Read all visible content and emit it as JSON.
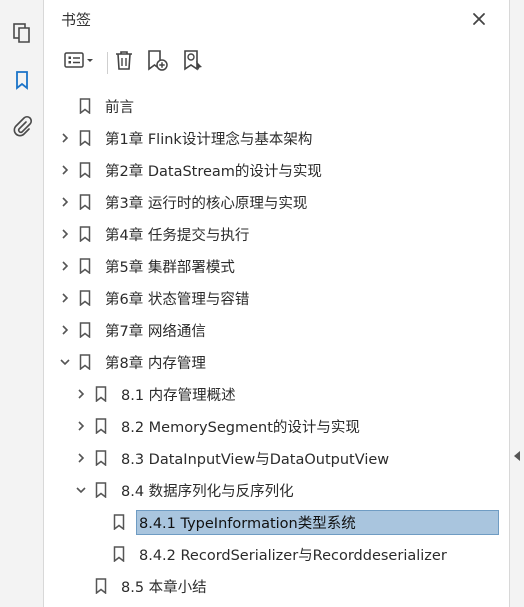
{
  "panel": {
    "title": "书签"
  },
  "rail": {
    "items": [
      "pages-icon",
      "bookmark-icon",
      "attachment-icon"
    ]
  },
  "toolbar": {
    "items": [
      "options-menu",
      "delete-bookmark",
      "new-bookmark",
      "find-current-bookmark"
    ]
  },
  "colors": {
    "accent": "#1a73c8",
    "selection": "#a9c5de",
    "selection_border": "#6f9cc3"
  },
  "bookmarks": [
    {
      "label": "前言",
      "expanded": null,
      "selected": false
    },
    {
      "label": "第1章 Flink设计理念与基本架构",
      "expanded": false,
      "selected": false
    },
    {
      "label": "第2章 DataStream的设计与实现",
      "expanded": false,
      "selected": false
    },
    {
      "label": "第3章 运行时的核心原理与实现",
      "expanded": false,
      "selected": false
    },
    {
      "label": "第4章 任务提交与执行",
      "expanded": false,
      "selected": false
    },
    {
      "label": "第5章 集群部署模式",
      "expanded": false,
      "selected": false
    },
    {
      "label": "第6章 状态管理与容错",
      "expanded": false,
      "selected": false
    },
    {
      "label": "第7章 网络通信",
      "expanded": false,
      "selected": false
    },
    {
      "label": "第8章 内存管理",
      "expanded": true,
      "selected": false
    },
    {
      "label": "8.1 内存管理概述",
      "expanded": false,
      "selected": false
    },
    {
      "label": "8.2 MemorySegment的设计与实现",
      "expanded": false,
      "selected": false
    },
    {
      "label": "8.3 DataInputView与DataOutputView",
      "expanded": false,
      "selected": false
    },
    {
      "label": "8.4 数据序列化与反序列化",
      "expanded": true,
      "selected": false
    },
    {
      "label": "8.4.1 TypeInformation类型系统",
      "expanded": null,
      "selected": true
    },
    {
      "label": "8.4.2 RecordSerializer与Recorddeserializer",
      "expanded": null,
      "selected": false
    },
    {
      "label": "8.5 本章小结",
      "expanded": null,
      "selected": false
    }
  ]
}
